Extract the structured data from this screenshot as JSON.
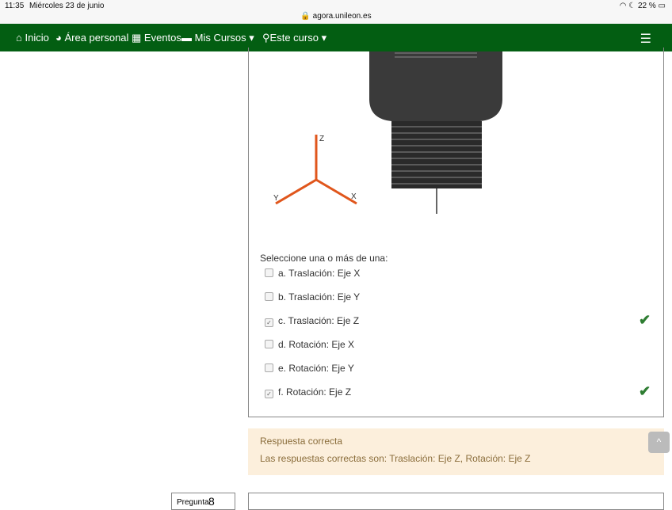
{
  "status_bar": {
    "time": "11:35",
    "date": "Miércoles 23 de junio",
    "url": "agora.unileon.es",
    "battery": "22 %"
  },
  "nav": {
    "items": [
      "Inicio",
      "Área personal",
      "Eventos",
      "Mis Cursos",
      "Este curso"
    ]
  },
  "question": {
    "axes": {
      "z": "Z",
      "y": "Y",
      "x": "X"
    },
    "prompt": "Seleccione una o más de una:",
    "options": [
      {
        "label": "a. Traslación: Eje X",
        "checked": false,
        "correct": false
      },
      {
        "label": "b. Traslación: Eje Y",
        "checked": false,
        "correct": false
      },
      {
        "label": "c. Traslación: Eje Z",
        "checked": true,
        "correct": true
      },
      {
        "label": "d. Rotación: Eje X",
        "checked": false,
        "correct": false
      },
      {
        "label": "e. Rotación: Eje Y",
        "checked": false,
        "correct": false
      },
      {
        "label": "f. Rotación: Eje Z",
        "checked": true,
        "correct": true
      }
    ]
  },
  "feedback": {
    "title": "Respuesta correcta",
    "text": "Las respuestas correctas son: Traslación: Eje Z, Rotación: Eje Z"
  },
  "next_question": {
    "label": "Pregunta",
    "number": "8"
  }
}
